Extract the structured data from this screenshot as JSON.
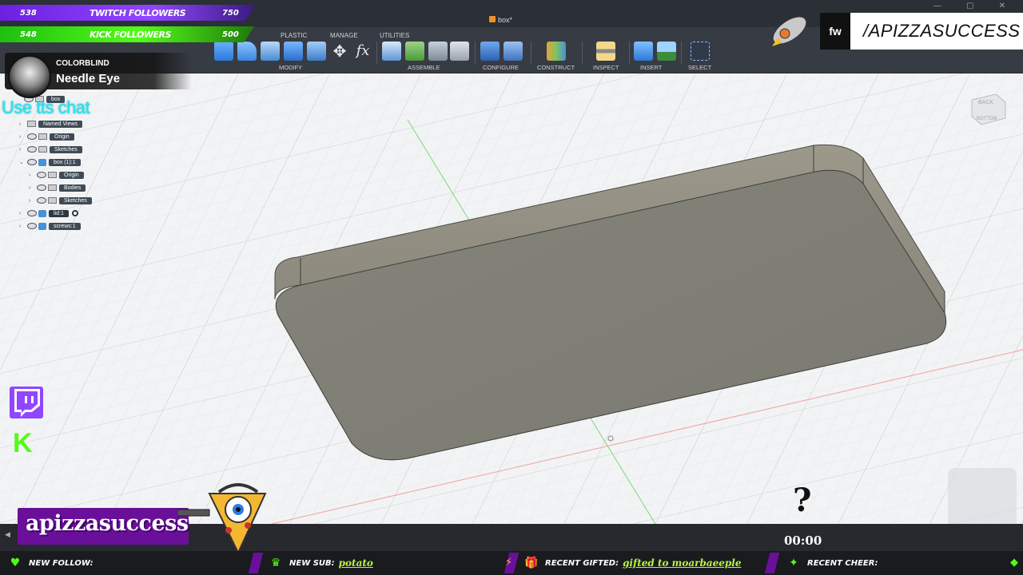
{
  "fusion": {
    "document_title": "box*",
    "ribbon_tabs": [
      "PLASTIC",
      "MANAGE",
      "UTILITIES"
    ],
    "ribbon_groups": [
      "MODIFY",
      "ASSEMBLE",
      "CONFIGURE",
      "CONSTRUCT",
      "INSPECT",
      "INSERT",
      "SELECT"
    ],
    "viewcube": {
      "top": "BACK",
      "front": "BOTTOM"
    }
  },
  "browser_tree": {
    "root": "box",
    "items": [
      {
        "label": "Named Views"
      },
      {
        "label": "Origin"
      },
      {
        "label": "Sketches"
      },
      {
        "label": "box (1):1"
      },
      {
        "label": "Origin"
      },
      {
        "label": "Bodies"
      },
      {
        "label": "Sketches"
      },
      {
        "label": "lid:1"
      },
      {
        "label": "screws:1"
      }
    ]
  },
  "overlay": {
    "twitch_followers": {
      "current": "538",
      "title": "TWITCH FOLLOWERS",
      "goal": "750"
    },
    "kick_followers": {
      "current": "548",
      "title": "KICK FOLLOWERS",
      "goal": "500"
    },
    "now_playing": {
      "label": "COLORBLIND",
      "title": "Needle Eye"
    },
    "tts_prompt": "Use tts chat",
    "handle": "/APIZZASUCCESS",
    "logo_text": "fw",
    "streamer_name": "apizzasuccess",
    "question_mark": "?",
    "timer": "00:00",
    "alerts": [
      {
        "label": "NEW FOLLOW:",
        "value": "",
        "icon": "heart-icon"
      },
      {
        "label": "NEW SUB:",
        "value": "potato",
        "icon": "crown-icon"
      },
      {
        "label": "RECENT GIFTED:",
        "value": "gifted to moarbaeeple",
        "icon": "gift-icon"
      },
      {
        "label": "RECENT CHEER:",
        "value": "",
        "icon": "cheer-icon"
      }
    ],
    "colors": {
      "twitch": "#9146ff",
      "kick": "#53fc18",
      "accent": "#6a0f9a",
      "tts": "#2fe0f2"
    }
  }
}
